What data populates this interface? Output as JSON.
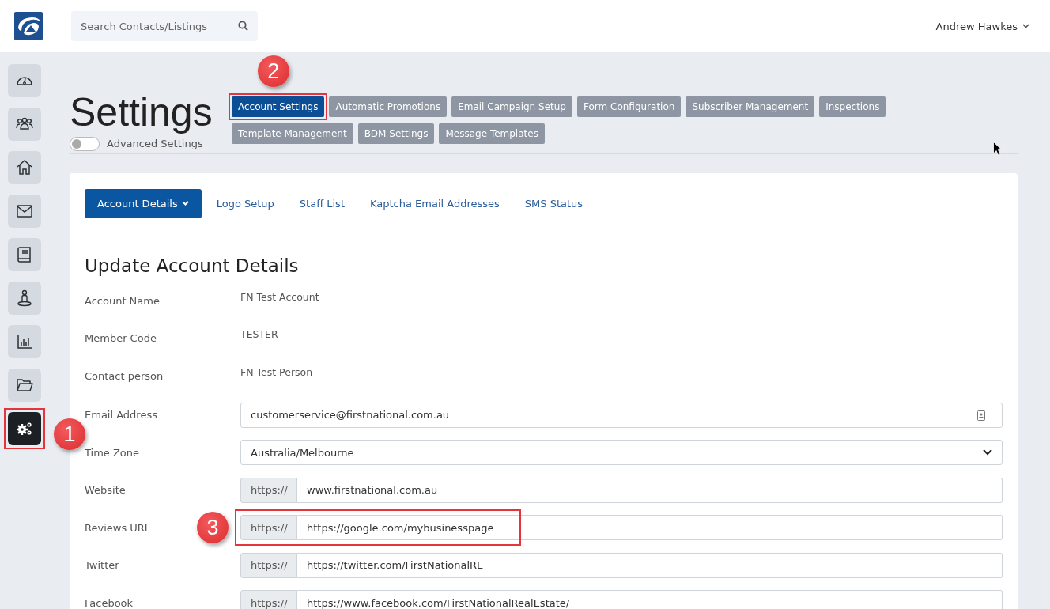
{
  "header": {
    "search": {
      "placeholder": "Search Contacts/Listings"
    },
    "user": "Andrew Hawkes"
  },
  "sidebar": {
    "items": [
      {
        "kind": "gauge",
        "selected": false
      },
      {
        "kind": "people",
        "selected": false
      },
      {
        "kind": "home",
        "selected": false
      },
      {
        "kind": "mail",
        "selected": false
      },
      {
        "kind": "book",
        "selected": false
      },
      {
        "kind": "person",
        "selected": false
      },
      {
        "kind": "chart",
        "selected": false
      },
      {
        "kind": "folder",
        "selected": false
      },
      {
        "kind": "gears",
        "selected": true,
        "callout": "1"
      }
    ]
  },
  "page": {
    "title": "Settings",
    "advanced_toggle": {
      "label": "Advanced Settings",
      "on": false
    }
  },
  "tabs": [
    {
      "label": "Account Settings",
      "selected": true,
      "callout": "2"
    },
    {
      "label": "Automatic Promotions",
      "selected": false
    },
    {
      "label": "Email Campaign Setup",
      "selected": false
    },
    {
      "label": "Form Configuration",
      "selected": false
    },
    {
      "label": "Subscriber Management",
      "selected": false
    },
    {
      "label": "Inspections",
      "selected": false
    },
    {
      "label": "Template Management",
      "selected": false
    },
    {
      "label": "BDM Settings",
      "selected": false
    },
    {
      "label": "Message Templates",
      "selected": false
    }
  ],
  "subtabs": [
    {
      "label": "Account Details",
      "selected": true,
      "dropdown": true
    },
    {
      "label": "Logo Setup",
      "selected": false,
      "dropdown": false
    },
    {
      "label": "Staff List",
      "selected": false,
      "dropdown": false
    },
    {
      "label": "Kaptcha Email Addresses",
      "selected": false,
      "dropdown": false
    },
    {
      "label": "SMS Status",
      "selected": false,
      "dropdown": false
    }
  ],
  "form": {
    "title": "Update Account Details",
    "rows": [
      {
        "kind": "static",
        "label": "Account Name",
        "value": "FN Test Account"
      },
      {
        "kind": "static",
        "label": "Member Code",
        "value": "TESTER"
      },
      {
        "kind": "static",
        "label": "Contact person",
        "value": "FN Test Person"
      },
      {
        "kind": "input",
        "label": "Email Address",
        "value": "customerservice@firstnational.com.au"
      },
      {
        "kind": "select",
        "label": "Time Zone",
        "value": "Australia/Melbourne"
      },
      {
        "kind": "prefixed",
        "label": "Website",
        "prefix": "https://",
        "value": "www.firstnational.com.au"
      },
      {
        "kind": "prefixed",
        "label": "Reviews URL",
        "prefix": "https://",
        "value": "https://google.com/mybusinesspage",
        "callout": "3"
      },
      {
        "kind": "prefixed",
        "label": "Twitter",
        "prefix": "https://",
        "value": "https://twitter.com/FirstNationalRE"
      },
      {
        "kind": "prefixed",
        "label": "Facebook",
        "prefix": "https://",
        "value": "https://www.facebook.com/FirstNationalRealEstate/"
      }
    ]
  }
}
